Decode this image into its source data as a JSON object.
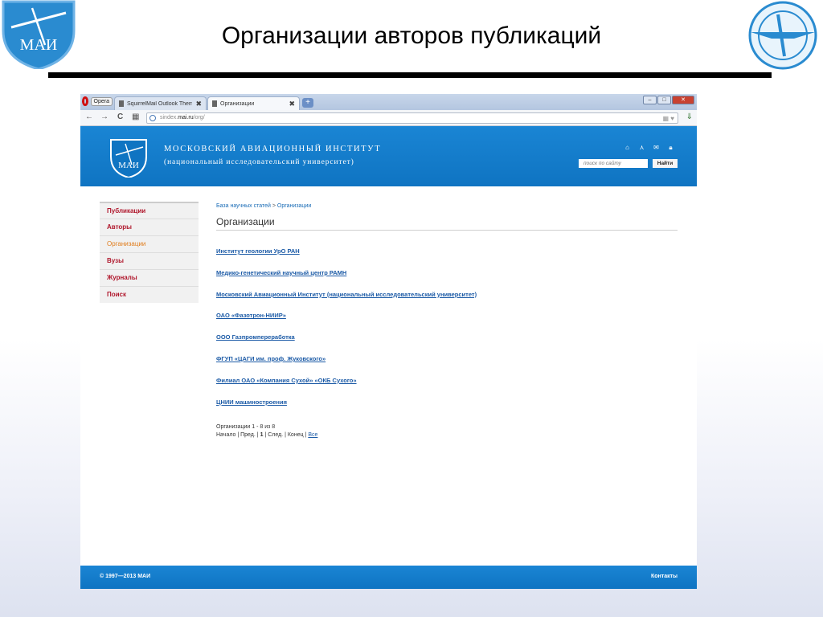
{
  "slide": {
    "title": "Организации авторов публикаций",
    "logo_left_text": "МАИ"
  },
  "browser": {
    "opera_label": "Opera",
    "tabs": [
      {
        "label": "SquirrelMail Outlook Theme",
        "close": "✖"
      },
      {
        "label": "Организации",
        "close": "✖"
      }
    ],
    "new_tab": "+",
    "window_buttons": {
      "minimize": "–",
      "maximize": "□",
      "close": "✕"
    },
    "nav": {
      "back": "←",
      "forward": "→",
      "reload": "C",
      "speed_dial": "▦"
    },
    "url": {
      "prefix": "sindex.",
      "host": "mai.ru",
      "path": "/org/"
    },
    "url_right_icons": "▦ ♥",
    "download_icon": "⇓"
  },
  "site": {
    "logo_text": "МАИ",
    "name_line1": "МОСКОВСКИЙ АВИАЦИОННЫЙ ИНСТИТУТ",
    "name_line2": "(национальный исследовательский университет)",
    "header_icons": [
      "home-icon",
      "sitemap-icon",
      "mail-icon",
      "lock-icon"
    ],
    "header_icon_glyphs": [
      "⌂",
      "⋏",
      "✉",
      "🔒︎"
    ],
    "search_placeholder": "поиск по сайту",
    "search_button": "Найти",
    "sidebar": [
      {
        "label": "Публикации"
      },
      {
        "label": "Авторы"
      },
      {
        "label": "Организации"
      },
      {
        "label": "Вузы"
      },
      {
        "label": "Журналы"
      },
      {
        "label": "Поиск"
      }
    ],
    "breadcrumb": {
      "home": "База научных статей",
      "sep": ">",
      "current": "Организации"
    },
    "page_title": "Организации",
    "organizations": [
      "Институт геологии УрО РАН",
      "Медико-генетический научный центр РАМН",
      "Московский Авиационный Институт (национальный исследовательский университет)",
      "ОАО «Фазотрон-НИИР»",
      "ООО Газпромпереработка",
      "ФГУП «ЦАГИ им. проф. Жуковского»",
      "Филиал ОАО «Компания Сухой» «ОКБ Сухого»",
      "ЦНИИ машиностроения"
    ],
    "pager_info": "Организации 1 - 8 из 8",
    "pager": {
      "start": "Начало",
      "prev": "Пред.",
      "page": "1",
      "next": "След.",
      "end": "Конец",
      "all": "Все",
      "sep": "|"
    },
    "footer": {
      "copyright": "© 1997—2013 МАИ",
      "contacts": "Контакты"
    }
  }
}
